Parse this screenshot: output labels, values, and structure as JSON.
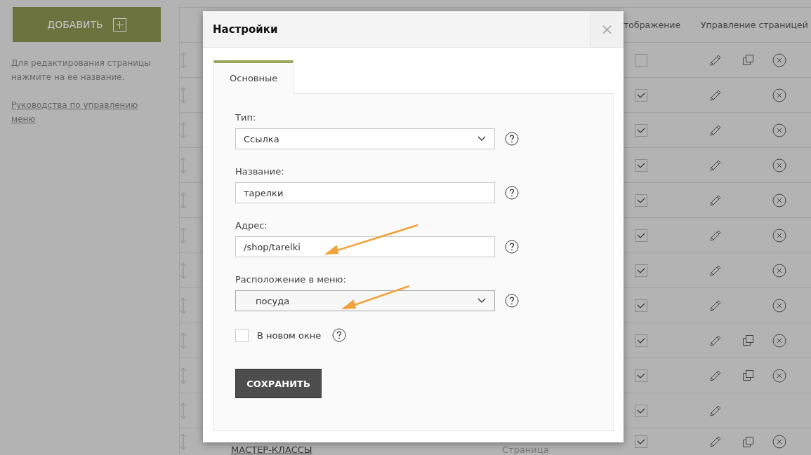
{
  "sidebar": {
    "add_button": "ДОБАВИТЬ",
    "hint": "Для редактирования страницы нажмите на ее название.",
    "guide_link": "Руководства по управлению меню"
  },
  "table": {
    "columns": [
      {
        "label": "тображение"
      },
      {
        "label": "Управление страницей"
      }
    ],
    "rows": [
      {
        "shown": false,
        "copyable": true,
        "deletable": true
      },
      {
        "shown": true,
        "copyable": false,
        "deletable": true
      },
      {
        "shown": true,
        "copyable": false,
        "deletable": true
      },
      {
        "shown": true,
        "copyable": false,
        "deletable": true
      },
      {
        "shown": true,
        "copyable": false,
        "deletable": true
      },
      {
        "shown": true,
        "copyable": false,
        "deletable": true
      },
      {
        "shown": true,
        "copyable": false,
        "deletable": true
      },
      {
        "shown": true,
        "copyable": false,
        "deletable": true
      },
      {
        "shown": true,
        "copyable": true,
        "deletable": true
      },
      {
        "shown": true,
        "copyable": true,
        "deletable": true
      },
      {
        "shown": true,
        "copyable": false,
        "deletable": false
      },
      {
        "name": "МАСТЕР-КЛАССЫ",
        "type": "Страница",
        "shown": true,
        "copyable": true,
        "deletable": true
      }
    ]
  },
  "modal": {
    "title": "Настройки",
    "close": "×",
    "tabs": [
      {
        "label": "Основные",
        "selected": true
      }
    ],
    "fields": [
      {
        "kind": "select",
        "label": "Тип:",
        "value": "Ссылка"
      },
      {
        "kind": "text",
        "label": "Название:",
        "value": "тарелки"
      },
      {
        "kind": "text",
        "label": "Адрес:",
        "value": "/shop/tarelki"
      },
      {
        "kind": "select",
        "label": "Расположение в меню:",
        "value": "посуда"
      }
    ],
    "new_window": {
      "label": "В новом окне",
      "checked": false
    },
    "save_button": "СОХРАНИТЬ"
  }
}
